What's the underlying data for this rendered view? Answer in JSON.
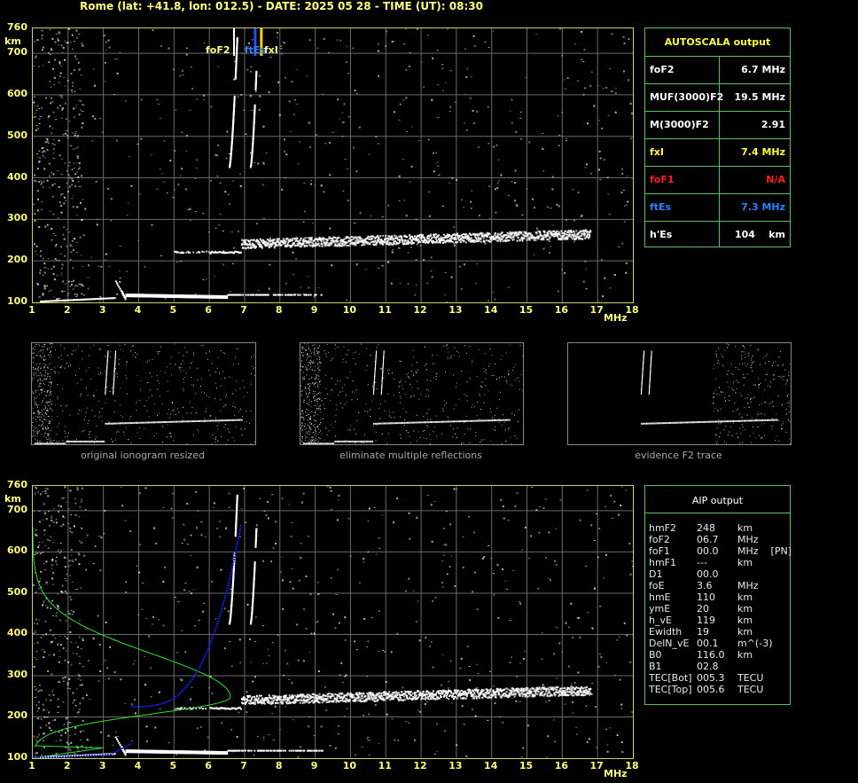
{
  "header": {
    "text": "Rome (lat: +41.8, lon: 012.5) - DATE: 2025 05 28 - TIME (UT): 08:30"
  },
  "axes": {
    "height_ticks": [
      "760",
      "700",
      "600",
      "500",
      "400",
      "300",
      "200",
      "100"
    ],
    "height_unit": "km",
    "freq_ticks": [
      "1",
      "2",
      "3",
      "4",
      "5",
      "6",
      "7",
      "8",
      "9",
      "10",
      "11",
      "12",
      "13",
      "14",
      "15",
      "16",
      "17",
      "18"
    ],
    "freq_unit": "MHz"
  },
  "markers": {
    "foF2_label": "foF2",
    "ftEs_label": "ftEs",
    "fxI_label": "fxI",
    "foF2_value": 6.7,
    "ftEs_value": 7.3,
    "fxI_value": 7.4
  },
  "thumbs": [
    {
      "caption": "original ionogram resized"
    },
    {
      "caption": "eliminate multiple reflections"
    },
    {
      "caption": "evidence F2 trace"
    }
  ],
  "autoscala": {
    "title": "AUTOSCALA output",
    "rows": [
      {
        "label": "foF2",
        "value": "6.7 MHz",
        "color": "#ffffff"
      },
      {
        "label": "MUF(3000)F2",
        "value": "19.5 MHz",
        "color": "#ffffff"
      },
      {
        "label": "M(3000)F2",
        "value": "2.91",
        "color": "#ffffff"
      },
      {
        "label": "fxI",
        "value": "7.4 MHz",
        "color": "#ffff40"
      },
      {
        "label": "foF1",
        "value": "N/A",
        "color": "#ff2020"
      },
      {
        "label": "ftEs",
        "value": "7.3 MHz",
        "color": "#3080ff"
      },
      {
        "label": "h'Es",
        "value": "104    km",
        "color": "#ffffff"
      }
    ]
  },
  "aip": {
    "title": "AIP output",
    "rows": [
      {
        "name": "hmF2",
        "value": "248",
        "unit": "km"
      },
      {
        "name": "foF2",
        "value": "06.7",
        "unit": "MHz"
      },
      {
        "name": "foF1",
        "value": "00.0",
        "unit": "MHz    [PN]"
      },
      {
        "name": "hmF1",
        "value": "---",
        "unit": "km"
      },
      {
        "name": "D1",
        "value": "00.0",
        "unit": ""
      },
      {
        "name": "foE",
        "value": "3.6",
        "unit": "MHz"
      },
      {
        "name": "hmE",
        "value": "110",
        "unit": "km"
      },
      {
        "name": "ymE",
        "value": "20",
        "unit": "km"
      },
      {
        "name": "h_vE",
        "value": "119",
        "unit": "km"
      },
      {
        "name": "Ewidth",
        "value": "19",
        "unit": "km"
      },
      {
        "name": "DelN_vE",
        "value": "00.1",
        "unit": "m^(-3)"
      },
      {
        "name": "B0",
        "value": "116.0",
        "unit": "km"
      },
      {
        "name": "B1",
        "value": "02.8",
        "unit": ""
      },
      {
        "name": "TEC[Bot]",
        "value": "005.3",
        "unit": "TECU"
      },
      {
        "name": "TEC[Top]",
        "value": "005.6",
        "unit": "TECU"
      }
    ]
  },
  "colors": {
    "axis_text": "#ffff80",
    "grid": "#6a6a6a",
    "trace": "#ffffff",
    "profile": "#30e030",
    "fitted_trace": "#1020e0",
    "foF2_marker": "#ffffff",
    "ftEs_marker": "#2050ff",
    "fxI_marker": "#ffd000",
    "panel_border": "#60c060"
  }
}
